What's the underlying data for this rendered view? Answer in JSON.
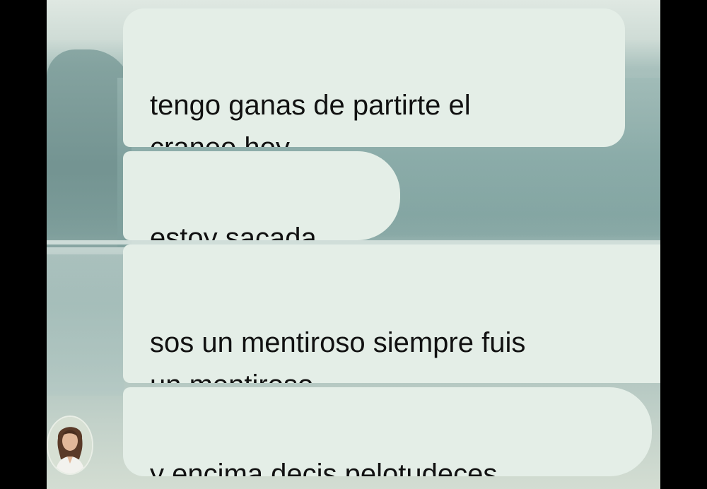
{
  "chat": {
    "messages": [
      {
        "text": "tengo ganas de partirte el\ncraneo hoy"
      },
      {
        "text": "estoy sacada"
      },
      {
        "text": "sos un mentiroso siempre fuis\nun mentiroso"
      },
      {
        "text": "y encima decis pelotudeces"
      }
    ],
    "avatar_icon": "user-avatar-photo",
    "colors": {
      "bubble": "#e4eee7",
      "text": "#111111"
    }
  }
}
